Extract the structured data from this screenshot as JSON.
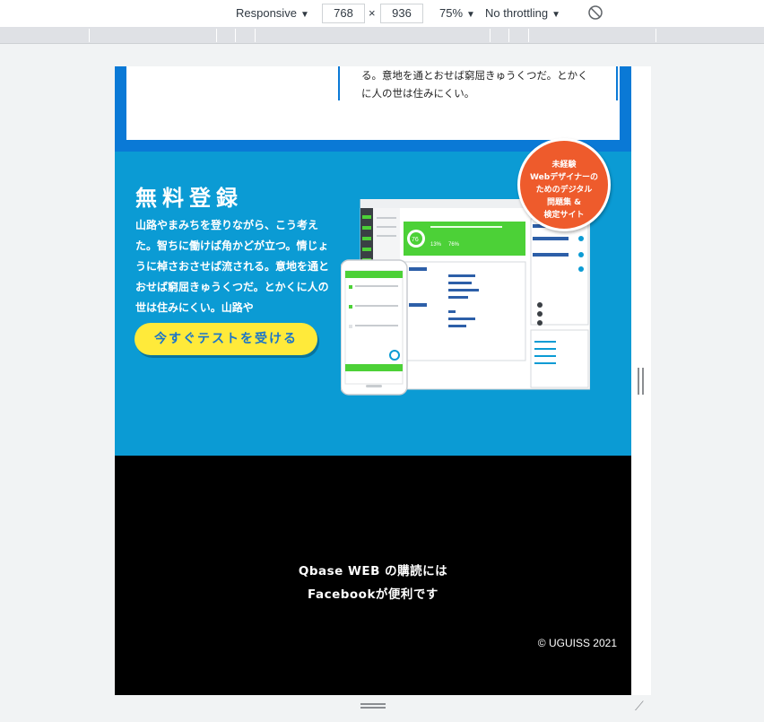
{
  "devtools": {
    "device": "Responsive",
    "width": "768",
    "times": "×",
    "height": "936",
    "zoom": "75%",
    "throttling": "No throttling"
  },
  "top_card": {
    "text": "る。意地を通とおせば窮屈きゅうくつだ。とかくに人の世は住みにくい。"
  },
  "registration": {
    "title": "無料登録",
    "body": "山路やまみちを登りながら、こう考えた。智ちに働けば角かどが立つ。情じょうに棹さおさせば流される。意地を通とおせば窮屈きゅうくつだ。とかくに人の世は住みにくい。山路や",
    "cta_label": "今すぐテストを受ける",
    "badge_lines": [
      "未経験",
      "Webデザイナーの",
      "ためのデジタル",
      "問題集 &",
      "検定サイト"
    ],
    "score_main": "76",
    "score_pct_1": "13%",
    "score_pct_2": "76%"
  },
  "footer": {
    "line1": "Qbase WEB の購読には",
    "line2": "Facebookが便利です",
    "copyright": "© UGUISS 2021"
  },
  "colors": {
    "blue_dark": "#0a79d6",
    "blue_section": "#0b9bd4",
    "cta_yellow": "#ffea3a",
    "badge_orange": "#ee5b2c",
    "green": "#4cd137"
  }
}
